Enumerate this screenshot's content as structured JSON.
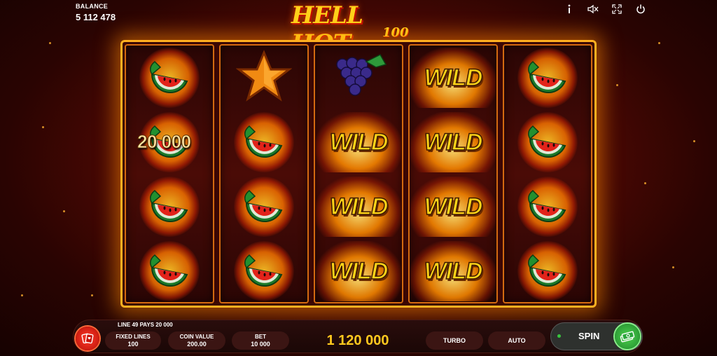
{
  "balance": {
    "label": "BALANCE",
    "value": "5 112 478"
  },
  "top_icons": [
    "info-icon",
    "mute-icon",
    "fullscreen-icon",
    "power-icon"
  ],
  "logo": {
    "main": "HELL HOT",
    "sub": "100"
  },
  "reels": [
    [
      "watermelon",
      "watermelon",
      "watermelon",
      "watermelon"
    ],
    [
      "star",
      "watermelon",
      "watermelon",
      "watermelon"
    ],
    [
      "grapes",
      "wild",
      "wild",
      "wild"
    ],
    [
      "wild",
      "wild",
      "wild",
      "wild"
    ],
    [
      "watermelon",
      "watermelon",
      "watermelon",
      "watermelon"
    ]
  ],
  "wild_text": "WILD",
  "win_amount": "20 000",
  "line_info": "LINE 49 PAYS 20 000",
  "controls": {
    "fixed_lines": {
      "label": "FIXED LINES",
      "value": "100"
    },
    "coin_value": {
      "label": "COIN VALUE",
      "value": "200.00"
    },
    "bet": {
      "label": "BET",
      "value": "10 000"
    },
    "total_win": "1 120 000",
    "turbo": "TURBO",
    "auto": "AUTO",
    "spin": "SPIN"
  },
  "colors": {
    "accent": "#ffc81e",
    "spin_green": "#39c63e",
    "frame": "#ffb020"
  }
}
